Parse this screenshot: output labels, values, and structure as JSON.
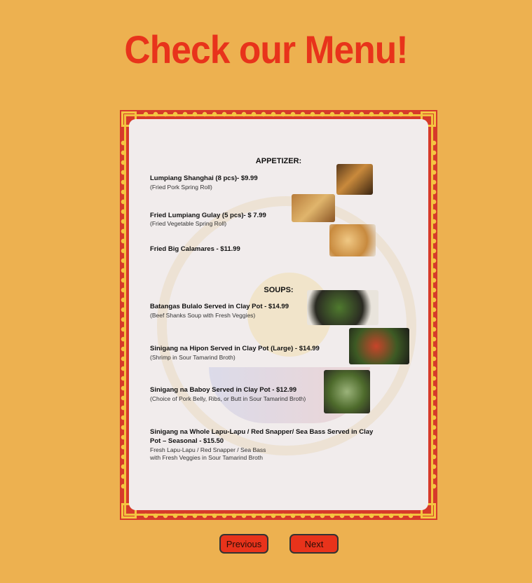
{
  "header": {
    "title": "Check our Menu!"
  },
  "menu": {
    "appetizer_heading": "APPETIZER:",
    "soups_heading": "SOUPS:",
    "appetizers": [
      {
        "name": "Lumpiang Shanghai (8 pcs)- $9.99",
        "desc": "(Fried Pork Spring Roll)",
        "image": "spring-rolls-photo"
      },
      {
        "name": "Fried Lumpiang Gulay (5 pcs)- $ 7.99",
        "desc": "(Fried Vegetable Spring Roll)",
        "image": "veggie-rolls-photo"
      },
      {
        "name": "Fried Big Calamares - $11.99",
        "desc": "",
        "image": "calamari-photo"
      }
    ],
    "soups": [
      {
        "name": "Batangas Bulalo Served in Clay Pot - $14.99",
        "desc": "(Beef Shanks Soup with Fresh Veggies)",
        "image": "bulalo-photo"
      },
      {
        "name": "Sinigang na Hipon Served in Clay Pot (Large) - $14.99",
        "desc": "(Shrimp in Sour Tamarind Broth)",
        "image": "hipon-photo"
      },
      {
        "name": "Sinigang na Baboy Served in Clay Pot - $12.99",
        "desc": "(Choice of Pork Belly, Ribs, or Butt in Sour Tamarind Broth)",
        "image": "baboy-photo"
      },
      {
        "name_line1": "Sinigang na Whole Lapu-Lapu / Red Snapper/ Sea Bass Served in Clay",
        "name_line2": "Pot – Seasonal - $15.50",
        "desc_line1": "Fresh Lapu-Lapu / Red Snapper / Sea Bass",
        "desc_line2": "with Fresh Veggies in Sour Tamarind Broth"
      }
    ]
  },
  "nav": {
    "previous_label": "Previous",
    "next_label": "Next"
  },
  "colors": {
    "background": "#EDB150",
    "title": "#E8331B",
    "frame": "#D63A2A",
    "button": "#E8331B"
  }
}
